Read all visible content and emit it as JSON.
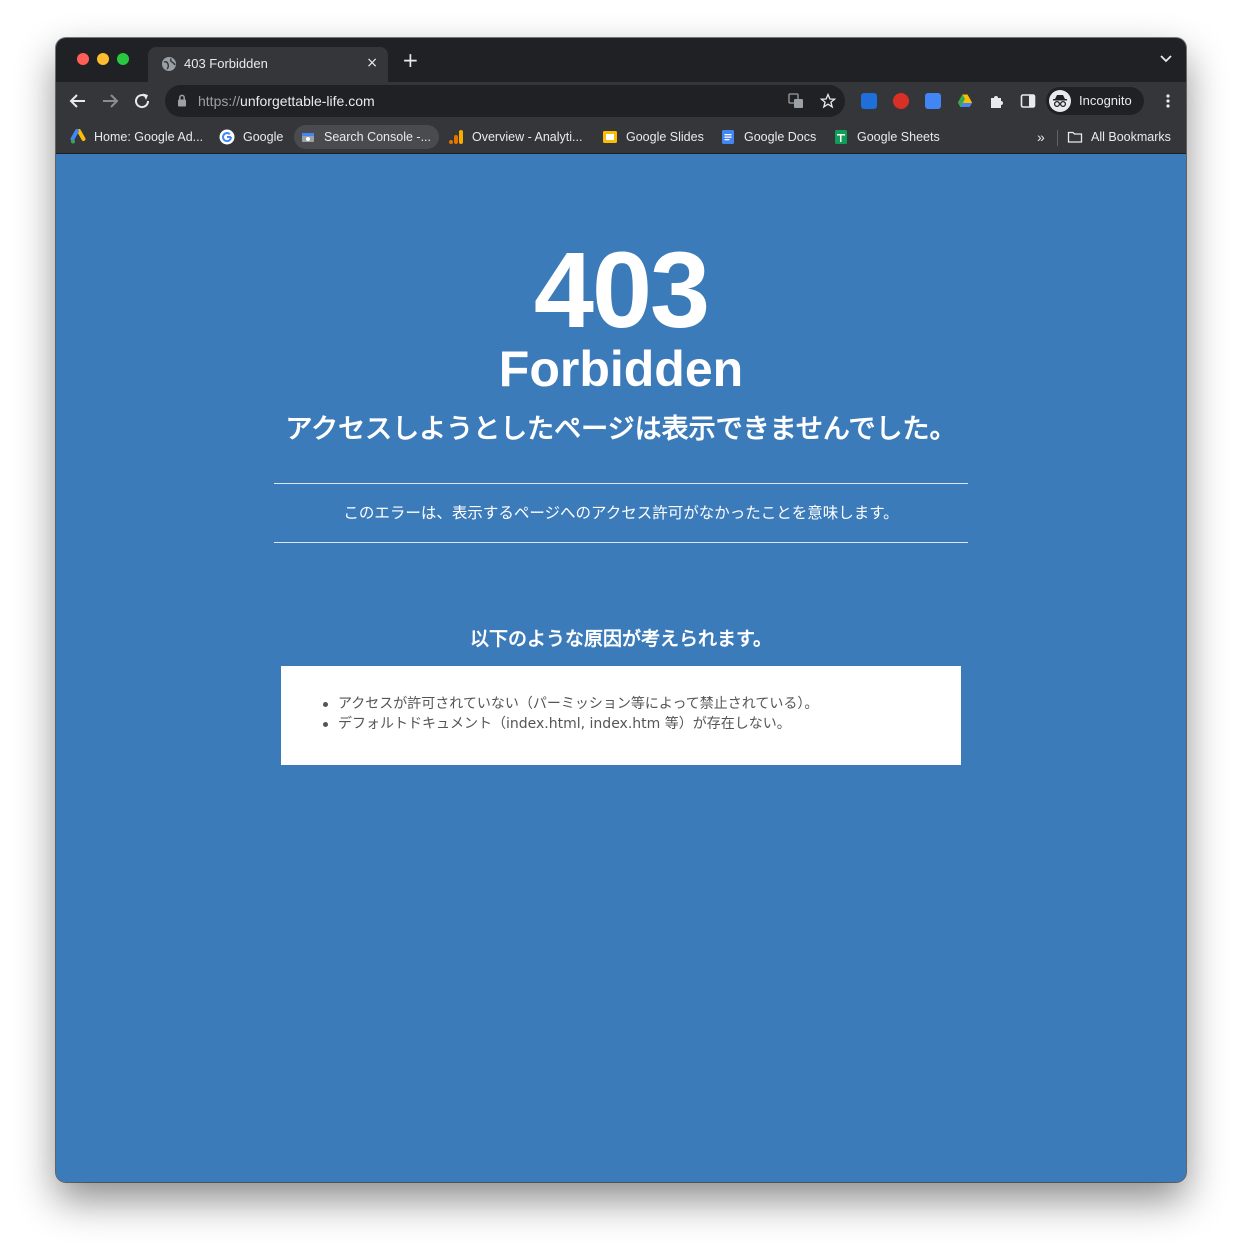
{
  "browser": {
    "tab_title": "403 Forbidden",
    "tab_close": "×",
    "new_tab": "+",
    "url_scheme": "https://",
    "url_host": "unforgettable-life.com",
    "profile_label": "Incognito",
    "overflow_chevron": "»",
    "bookmarks": [
      {
        "label": "Home: Google Ad...",
        "icon": "google-ads-icon"
      },
      {
        "label": "Google",
        "icon": "google-icon"
      },
      {
        "label": "Search Console -...",
        "icon": "search-console-icon"
      },
      {
        "label": "Overview - Analyti...",
        "icon": "analytics-icon"
      },
      {
        "label": "Google Slides",
        "icon": "slides-icon"
      },
      {
        "label": "Google Docs",
        "icon": "docs-icon"
      },
      {
        "label": "Google Sheets",
        "icon": "sheets-icon"
      }
    ],
    "all_bookmarks": "All Bookmarks"
  },
  "page": {
    "code": "403",
    "status": "Forbidden",
    "headline": "アクセスしようとしたページは表示できませんでした。",
    "explanation": "このエラーは、表示するページへのアクセス許可がなかったことを意味します。",
    "causes_title": "以下のような原因が考えられます。",
    "causes": [
      "アクセスが許可されていない（パーミッション等によって禁止されている）。",
      "デフォルトドキュメント（index.html, index.htm 等）が存在しない。"
    ]
  },
  "colors": {
    "page_background": "#3c7bba",
    "chrome_dark": "#202124",
    "chrome_toolbar": "#35363a"
  }
}
